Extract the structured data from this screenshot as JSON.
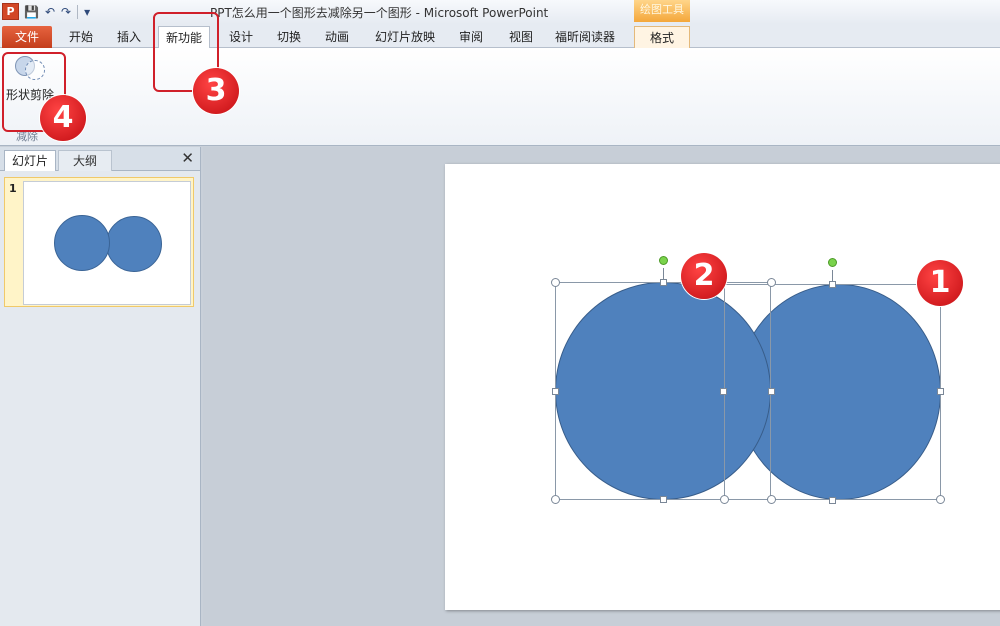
{
  "titlebar": {
    "app_icon": "P",
    "title": "PPT怎么用一个图形去减除另一个图形 - Microsoft PowerPoint",
    "context_group": "绘图工具",
    "qat_icons": [
      "save-icon",
      "undo-icon",
      "redo-icon",
      "customize-icon"
    ]
  },
  "tabs": {
    "file": "文件",
    "home": "开始",
    "insert": "插入",
    "new_features": "新功能",
    "design": "设计",
    "transitions": "切换",
    "animations": "动画",
    "slideshow": "幻灯片放映",
    "review": "审阅",
    "view": "视图",
    "foxit": "福昕阅读器",
    "format": "格式"
  },
  "ribbon": {
    "shape_subtract_label": "形状剪除",
    "group_label": "减除"
  },
  "panel": {
    "slides_tab": "幻灯片",
    "outline_tab": "大纲",
    "close_glyph": "✕",
    "slide_number": "1"
  },
  "annotations": {
    "badge_1": "1",
    "badge_2": "2",
    "badge_3": "3",
    "badge_4": "4"
  },
  "colors": {
    "shape_fill": "#4f81bd",
    "annotation_red": "#d0202a",
    "file_tab": "#d24726"
  }
}
